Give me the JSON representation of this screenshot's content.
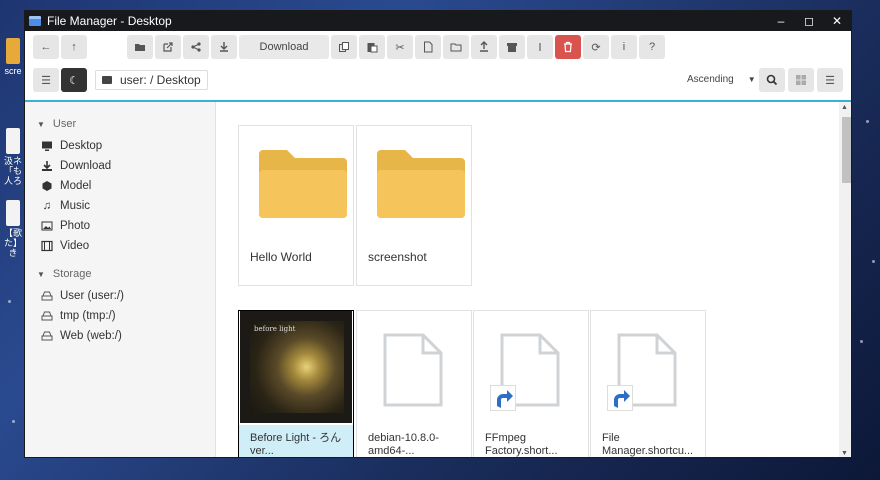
{
  "window": {
    "title": "File Manager - Desktop"
  },
  "desktop": {
    "icons": [
      {
        "label": "scre"
      },
      {
        "label": "汲ネ「も人ろ"
      },
      {
        "label": "【歌た】き"
      }
    ]
  },
  "toolbar": {
    "download_label": "Download",
    "sort_label": "Ascending"
  },
  "path": {
    "text": "user: / Desktop"
  },
  "sidebar": {
    "user_heading": "User",
    "items": [
      {
        "label": "Desktop",
        "icon": "monitor-icon"
      },
      {
        "label": "Download",
        "icon": "download-icon"
      },
      {
        "label": "Model",
        "icon": "cube-icon"
      },
      {
        "label": "Music",
        "icon": "music-icon"
      },
      {
        "label": "Photo",
        "icon": "image-icon"
      },
      {
        "label": "Video",
        "icon": "film-icon"
      }
    ],
    "storage_heading": "Storage",
    "storage": [
      {
        "label": "User (user:/)"
      },
      {
        "label": "tmp (tmp:/)"
      },
      {
        "label": "Web (web:/)"
      }
    ]
  },
  "files": {
    "folders": [
      {
        "name": "Hello World"
      },
      {
        "name": "screenshot"
      }
    ],
    "items": [
      {
        "name": "Before Light - ろん ver...",
        "thumb_caption": "before light"
      },
      {
        "name": "debian-10.8.0-amd64-..."
      },
      {
        "name": "FFmpeg Factory.short..."
      },
      {
        "name": "File Manager.shortcu..."
      }
    ]
  },
  "colors": {
    "accent": "#3ab0d8",
    "folder": "#f5c45b",
    "delete": "#d9534f",
    "selected": "#cfeef8"
  }
}
